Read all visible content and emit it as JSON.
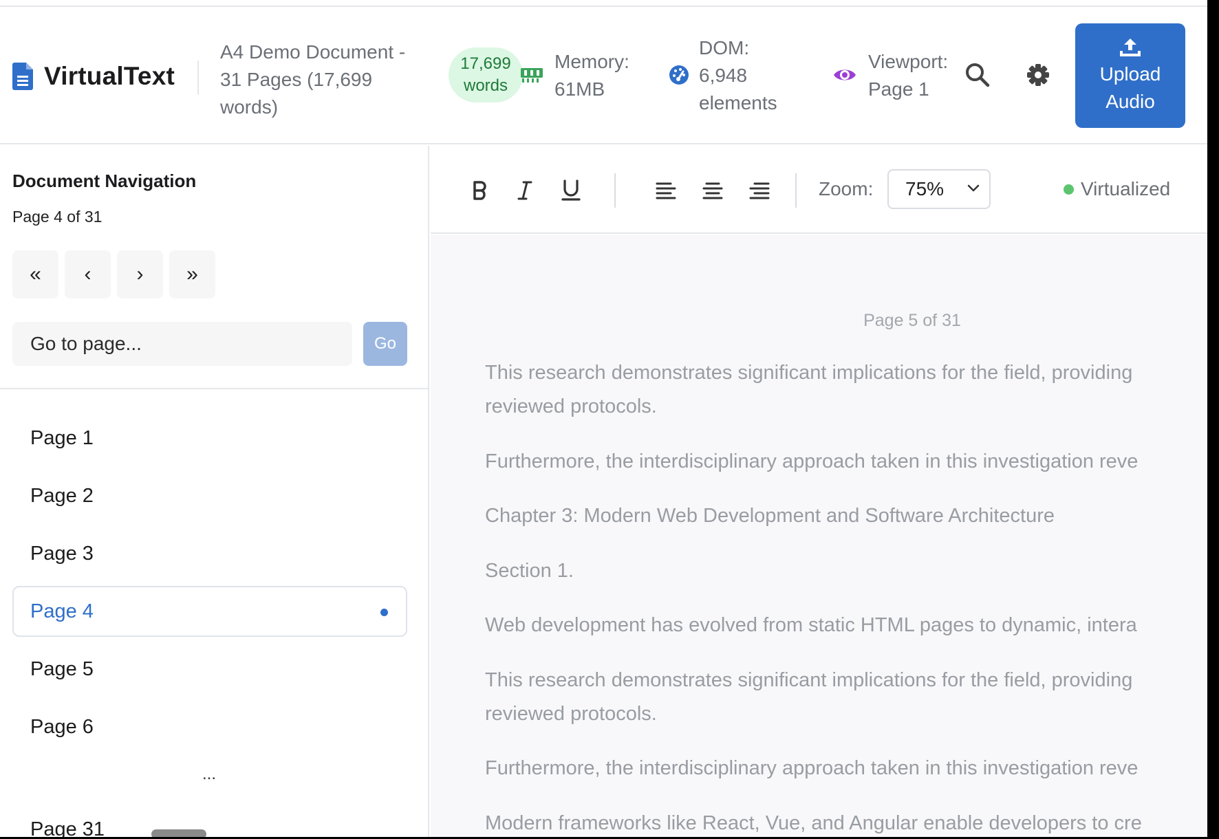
{
  "header": {
    "app_name": "VirtualText",
    "doc_title": "A4 Demo Document - 31 Pages (17,699 words)",
    "word_pill_line1": "17,699",
    "word_pill_line2": "words",
    "memory_line1": "Memory:",
    "memory_line2": "61MB",
    "dom_line1": "DOM:",
    "dom_line2": "6,948",
    "dom_line3": "elements",
    "viewport_line1": "Viewport:",
    "viewport_line2": "Page 1",
    "upload_line1": "Upload",
    "upload_line2": "Audio"
  },
  "sidebar": {
    "title": "Document Navigation",
    "subtitle": "Page 4 of 31",
    "pager": {
      "first": "«",
      "prev": "‹",
      "next": "›",
      "last": "»"
    },
    "goto_placeholder": "Go to page...",
    "go_label": "Go",
    "pages": [
      "Page 1",
      "Page 2",
      "Page 3",
      "Page 4",
      "Page 5",
      "Page 6"
    ],
    "active_page": "Page 4",
    "ellipsis": "...",
    "last_page": "Page 31"
  },
  "toolbar": {
    "zoom_label": "Zoom:",
    "zoom_value": "75%",
    "virtualized_label": "Virtualized"
  },
  "content": {
    "page_label": "Page 5 of 31",
    "paragraphs": [
      "This research demonstrates significant implications for the field, providing",
      "reviewed protocols.",
      "Furthermore, the interdisciplinary approach taken in this investigation reve",
      "Chapter 3: Modern Web Development and Software Architecture",
      "Section 1.",
      "Web development has evolved from static HTML pages to dynamic, intera",
      "This research demonstrates significant implications for the field, providing",
      "reviewed protocols.",
      "Furthermore, the interdisciplinary approach taken in this investigation reve",
      "Modern frameworks like React, Vue, and Angular enable developers to cre"
    ]
  },
  "colors": {
    "accent": "#2f6fc9",
    "memory_icon": "#3aa35a",
    "dom_icon": "#2f6fc9",
    "viewport_icon": "#9b3fd4",
    "virtualized_dot": "#5cc56f",
    "word_pill_bg": "#dcf7e3"
  },
  "icons": {
    "doc": "document-icon",
    "memory": "memory-chip-icon",
    "dom": "gauge-icon",
    "viewport": "eye-icon",
    "search": "search-icon",
    "settings": "gear-icon",
    "upload": "upload-icon"
  }
}
